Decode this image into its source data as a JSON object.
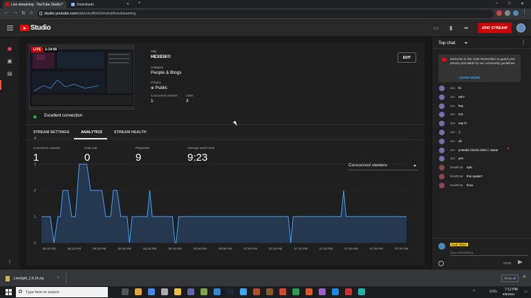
{
  "browser": {
    "tabs": [
      {
        "label": "Live streaming - YouTube Studio",
        "icon_color": "#ff0000"
      },
      {
        "label": "Downloads",
        "icon_color": "#8ab4f8"
      }
    ],
    "new_tab_symbol": "+",
    "window_controls": [
      "–",
      "□",
      "✕"
    ],
    "nav": {
      "back": "←",
      "forward": "→",
      "reload": "↻",
      "home": "⌂"
    },
    "url_host": "studio.youtube.com",
    "url_path": "/video/ezBrkG0mdck/livestreaming"
  },
  "studio_header": {
    "brand": "Studio",
    "end_stream_label": "END STREAM",
    "icons": [
      "captions-icon",
      "bookmark-icon",
      "share-icon"
    ]
  },
  "left_rail": {
    "icons": [
      "live-icon",
      "camera-icon",
      "calendar-icon",
      "feedback-icon"
    ]
  },
  "stream": {
    "live_label": "LIVE",
    "elapsed": "1:14:56",
    "title_label": "Title",
    "title": "HEXEN!!!",
    "category_label": "Category",
    "category": "People & Blogs",
    "privacy_label": "Privacy",
    "privacy": "Public",
    "concurrent_label": "Concurrent viewers",
    "concurrent": "1",
    "likes_label": "Likes",
    "likes": "3",
    "edit_label": "EDIT",
    "connection": "Excellent connection"
  },
  "tabs": {
    "items": [
      "STREAM SETTINGS",
      "ANALYTICS",
      "STREAM HEALTH"
    ],
    "active": "ANALYTICS"
  },
  "stats": [
    {
      "label": "Concurrent viewers",
      "value": "1"
    },
    {
      "label": "Chat rate",
      "value": "0"
    },
    {
      "label": "Playbacks",
      "value": "9"
    },
    {
      "label": "Average watch time",
      "value": "9:23"
    }
  ],
  "metric_select": {
    "selected": "Concurrent viewers"
  },
  "chart_data": {
    "type": "area",
    "title": "",
    "xlabel": "",
    "ylabel": "",
    "ylim": [
      0,
      4
    ],
    "yticks": [
      0,
      1,
      2,
      3,
      4
    ],
    "xticks": [
      "06:20 PM",
      "06:25 PM",
      "06:30 PM",
      "06:35 PM",
      "06:40 PM",
      "06:45 PM",
      "06:50 PM",
      "06:55 PM",
      "07:00 PM",
      "07:05 PM",
      "07:10 PM",
      "07:15 PM",
      "07:20 PM",
      "07:25 PM",
      "07:30 PM"
    ],
    "grid": true,
    "color": "#3ea6ff",
    "fill": "#263850",
    "series": [
      {
        "x": [
          -0.3,
          0.05,
          0.2,
          0.35,
          0.45,
          0.55,
          0.75,
          0.9,
          1.05,
          1.2,
          1.5,
          1.65,
          1.75,
          1.95,
          2.1,
          2.25,
          2.45,
          2.55,
          2.7,
          2.85,
          3.1,
          3.2,
          3.3,
          3.4,
          3.9,
          4.0,
          4.1,
          4.2,
          4.9,
          5.0,
          5.05,
          5.15,
          5.3,
          6.0,
          7.0,
          8.0,
          9.5,
          9.6,
          9.7,
          10.0,
          11.0,
          11.6,
          11.7,
          11.8,
          12.5,
          13.0,
          14.0,
          14.2
        ],
        "y": [
          1,
          1,
          0,
          1,
          1,
          2,
          2,
          1,
          1,
          3,
          3,
          2,
          2,
          2,
          2,
          1,
          1,
          2,
          2,
          1,
          1,
          0,
          1,
          1,
          1,
          2,
          1,
          1,
          1,
          0,
          0,
          1,
          1,
          1,
          1,
          1,
          1,
          0,
          1,
          1,
          1,
          1,
          2,
          1,
          1,
          1,
          1,
          1
        ]
      }
    ]
  },
  "chat": {
    "title": "Top chat",
    "welcome": "Welcome to live chat! Remember to guard your privacy and abide by our community guidelines.",
    "learn_more": "LEARN MORE",
    "messages": [
      {
        "name": "zav",
        "text": "hi"
      },
      {
        "name": "zav",
        "text": "HEY"
      },
      {
        "name": "zav",
        "text": "hey"
      },
      {
        "name": "zav",
        "text": "mic"
      },
      {
        "name": "zav",
        "text": "say hi"
      },
      {
        "name": "zav",
        "text": ":("
      },
      {
        "name": "zav",
        "text": "ok"
      },
      {
        "name": "zav",
        "text": "youtube blocks when i swear",
        "emoji": "♥"
      },
      {
        "name": "zav",
        "text": "yes"
      },
      {
        "name": "DestRcat",
        "text": "epic"
      },
      {
        "name": "DestRcat",
        "text": "this quake?"
      },
      {
        "name": "DestRcat",
        "text": "finxx"
      }
    ],
    "current_user": "Cool Vibes",
    "input_placeholder": "Say something...",
    "char_count": "0/200"
  },
  "downloads": {
    "file": "LiveSplit_1.8.16.zip",
    "caret": "^",
    "show_all": "Show all",
    "close": "✕"
  },
  "taskbar": {
    "search_placeholder": "Type here to search",
    "apps": [
      "#555",
      "#e8a33d",
      "#4285f4",
      "#aaa",
      "#f0c040",
      "#6264a7",
      "#7aa34a",
      "#2c89d6",
      "#1b2838",
      "#3ea6ff",
      "#b04b2b",
      "#8b5a2b",
      "#d14836",
      "#2d9b4b",
      "#e25822",
      "#9b5fc0",
      "#1e88e5",
      "#cc3333",
      "#20b2aa"
    ],
    "lang": "ENG",
    "time": "7:12 PM",
    "date": "6/5/2021"
  }
}
